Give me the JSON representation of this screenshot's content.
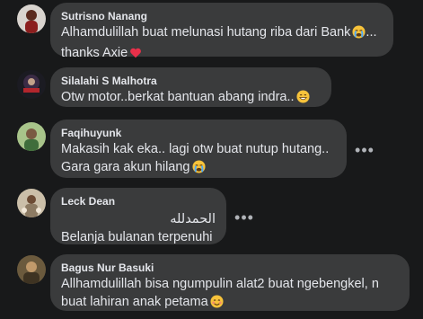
{
  "comments": [
    {
      "author": "Sutrisno Nanang",
      "lines": [
        "Alhamdulillah buat melunasi hutang riba dari Bank",
        "thanks Axie"
      ],
      "line_emojis": [
        "crying-face-emoji",
        "red-heart-emoji"
      ],
      "line_suffix": [
        "...",
        ""
      ]
    },
    {
      "author": "Silalahi S Malhotra",
      "lines": [
        "Otw motor..berkat bantuan abang indra.."
      ],
      "line_emojis": [
        "grinning-face-emoji"
      ]
    },
    {
      "author": "Faqihuyunk",
      "lines": [
        "Makasih kak eka.. lagi otw buat nutup hutang..",
        "Gara gara akun hilang"
      ],
      "line_emojis": [
        "",
        "crying-face-emoji"
      ],
      "more_label": "•••"
    },
    {
      "author": "Leck Dean",
      "lines": [
        "الحمدلله",
        "Belanja bulanan terpenuhi"
      ],
      "more_label": "•••"
    },
    {
      "author": "Bagus Nur Basuki",
      "lines": [
        "Allhamdulillah bisa ngumpulin alat2 buat ngebengkel, n",
        "buat lahiran anak petama"
      ],
      "line_emojis": [
        "",
        "smiling-face-emoji"
      ]
    }
  ],
  "colors": {
    "background": "#18191a",
    "bubble": "#3a3b3c",
    "text": "#e4e6eb",
    "secondary": "#b0b3b8"
  }
}
